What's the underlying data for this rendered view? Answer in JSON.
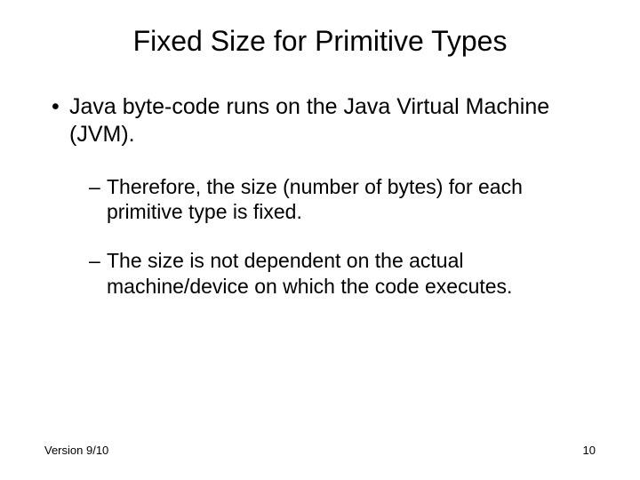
{
  "title": "Fixed Size for Primitive Types",
  "bullets": {
    "b1": "Java byte-code runs on the Java Virtual Machine (JVM).",
    "b1a": "Therefore, the size (number of bytes) for each primitive type is fixed.",
    "b1b": "The size is not dependent on the actual machine/device on which the code executes."
  },
  "footer": {
    "version": "Version 9/10",
    "page": "10"
  }
}
